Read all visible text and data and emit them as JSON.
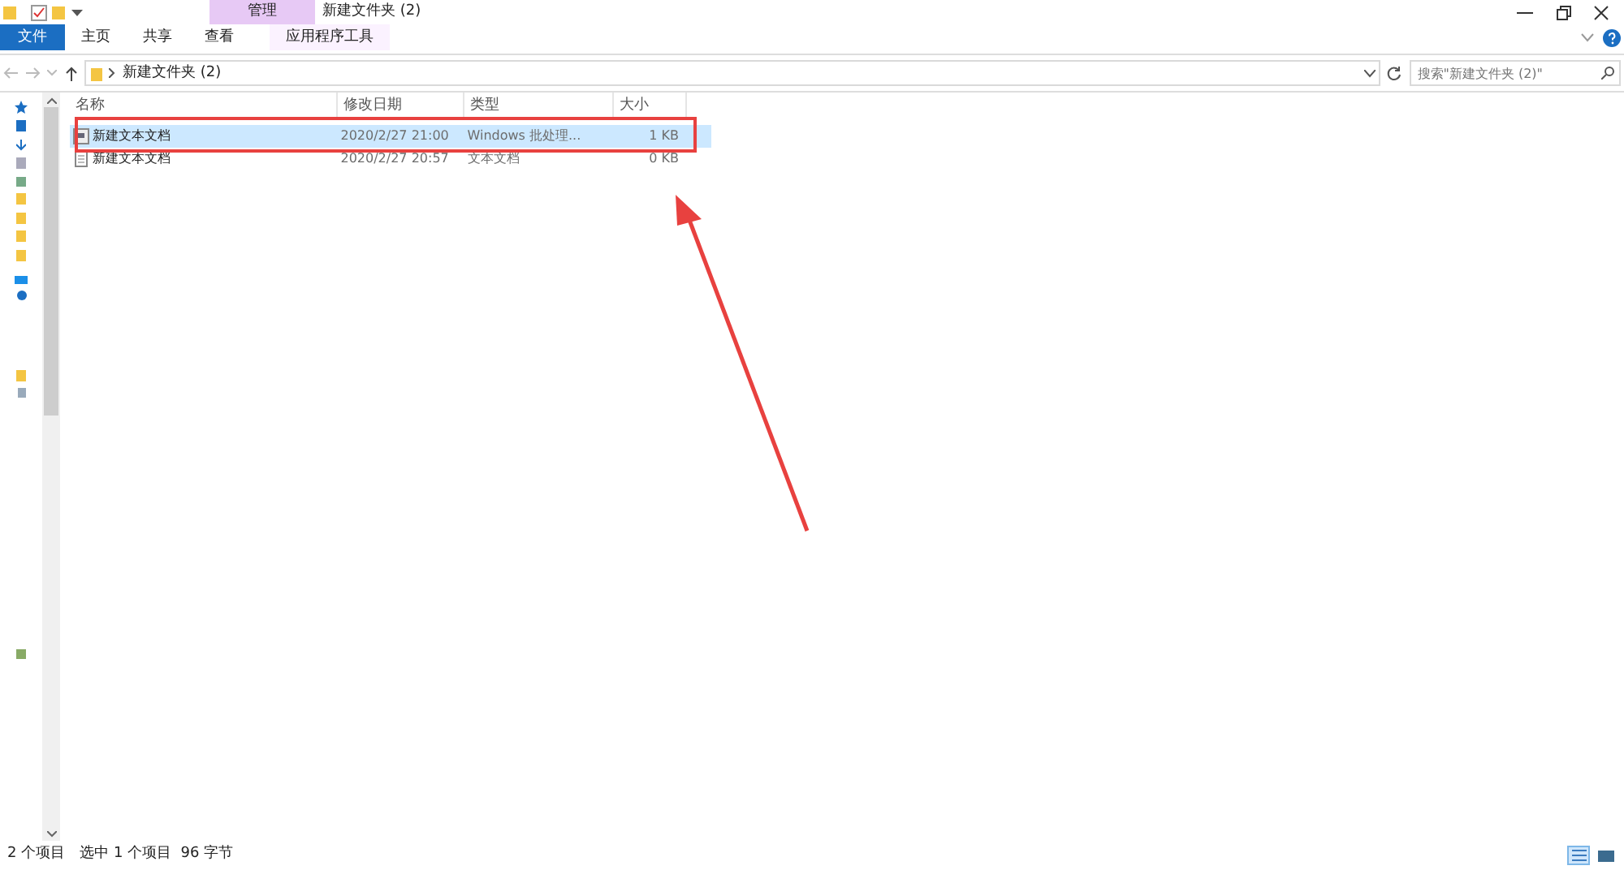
{
  "window": {
    "context_tab": "管理",
    "title": "新建文件夹 (2)"
  },
  "ribbon_tabs": [
    {
      "label": "文件",
      "kind": "file",
      "selected": false
    },
    {
      "label": "主页",
      "kind": "tab",
      "selected": false
    },
    {
      "label": "共享",
      "kind": "tab",
      "selected": false
    },
    {
      "label": "查看",
      "kind": "tab",
      "selected": false
    },
    {
      "label": "应用程序工具",
      "kind": "context",
      "selected": false
    }
  ],
  "address_bar": {
    "path": "新建文件夹 (2)"
  },
  "search": {
    "placeholder": "搜索\"新建文件夹 (2)\""
  },
  "table": {
    "columns": [
      "名称",
      "修改日期",
      "类型",
      "大小"
    ],
    "rows": [
      {
        "name": "新建文本文档",
        "date": "2020/2/27 21:00",
        "type": "Windows 批处理...",
        "size": "1 KB",
        "kind": "batch",
        "selected": true,
        "annotated": true
      },
      {
        "name": "新建文本文档",
        "date": "2020/2/27 20:57",
        "type": "文本文档",
        "size": "0 KB",
        "kind": "text",
        "selected": false,
        "annotated": false
      }
    ]
  },
  "status_bar": {
    "count": "2 个项目",
    "selection": "选中 1 个项目  96 字节"
  },
  "views": [
    {
      "kind": "details",
      "selected": true
    },
    {
      "kind": "tiles",
      "selected": false
    }
  ]
}
